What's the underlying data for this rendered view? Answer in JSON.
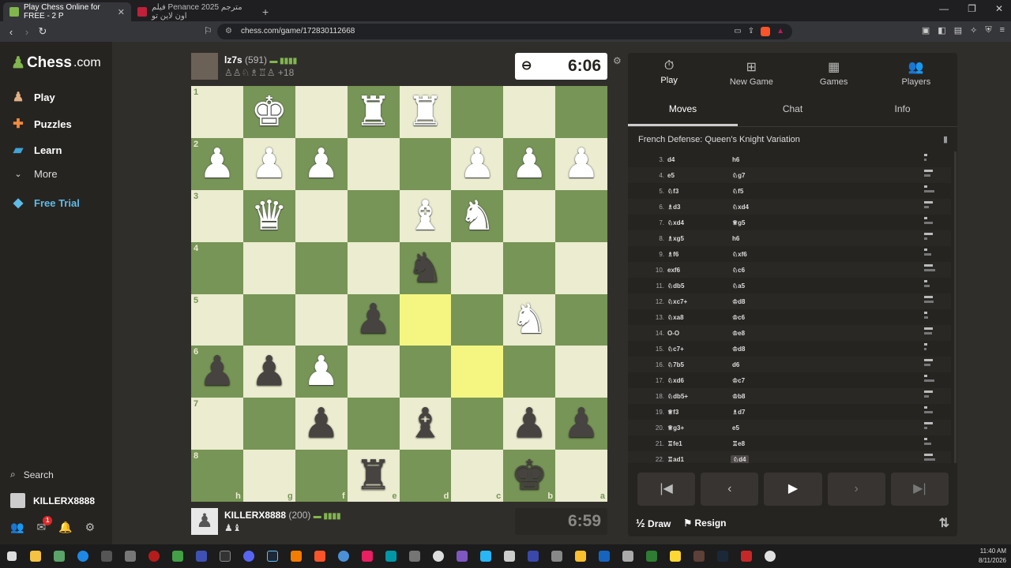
{
  "browser": {
    "tabs": [
      {
        "title": "Play Chess Online for FREE - 2 P",
        "active": true
      },
      {
        "title": "فیلم Penance 2025 مترجم اون لاین تو",
        "active": false
      }
    ],
    "url": "chess.com/game/172830112668"
  },
  "sidebar": {
    "logo_main": "Chess",
    "logo_suffix": ".com",
    "items": [
      {
        "label": "Play",
        "icon": "play-icon"
      },
      {
        "label": "Puzzles",
        "icon": "puzzle-icon"
      },
      {
        "label": "Learn",
        "icon": "learn-icon"
      },
      {
        "label": "More",
        "icon": "chevron-down-icon"
      },
      {
        "label": "Free Trial",
        "icon": "diamond-icon"
      }
    ],
    "search_label": "Search",
    "username": "KILLERX8888",
    "notifications": "1"
  },
  "top_player": {
    "name": "lz7s",
    "rating": "(591)",
    "captured": "♙♙♘♗♖♙ +18",
    "clock": "6:06"
  },
  "bottom_player": {
    "name": "KILLERX8888",
    "rating": "(200)",
    "captured": "♟♝",
    "clock": "6:59"
  },
  "board": {
    "orientation": "black",
    "ranks": [
      "1",
      "2",
      "3",
      "4",
      "5",
      "6",
      "7",
      "8"
    ],
    "files": [
      "h",
      "g",
      "f",
      "e",
      "d",
      "c",
      "b",
      "a"
    ],
    "rows": [
      [
        "",
        "wK",
        "",
        "wR",
        "wR",
        "",
        "",
        ""
      ],
      [
        "wP",
        "wP",
        "wP",
        "",
        "",
        "wP",
        "wP",
        "wP"
      ],
      [
        "",
        "wQ",
        "",
        "",
        "wB",
        "wN",
        "",
        ""
      ],
      [
        "",
        "",
        "",
        "",
        "bN",
        "",
        "",
        ""
      ],
      [
        "",
        "",
        "",
        "bP",
        "",
        "",
        "wN",
        ""
      ],
      [
        "bP",
        "bP",
        "wP",
        "",
        "",
        "",
        "",
        ""
      ],
      [
        "",
        "",
        "bP",
        "",
        "bB",
        "",
        "bP",
        "bP"
      ],
      [
        "",
        "",
        "",
        "bR",
        "",
        "",
        "bK",
        ""
      ]
    ],
    "highlights": [
      "4-4",
      "5-5"
    ]
  },
  "panel": {
    "tabs": [
      "Play",
      "New Game",
      "Games",
      "Players"
    ],
    "subtabs": [
      "Moves",
      "Chat",
      "Info"
    ],
    "opening": "French Defense: Queen's Knight Variation",
    "moves": [
      [
        "3.",
        "d4",
        "h6"
      ],
      [
        "4.",
        "e5",
        "♘g7"
      ],
      [
        "5.",
        "♘f3",
        "♘f5"
      ],
      [
        "6.",
        "♗d3",
        "♘xd4"
      ],
      [
        "7.",
        "♘xd4",
        "♕g5"
      ],
      [
        "8.",
        "♗xg5",
        "h6"
      ],
      [
        "9.",
        "♗f6",
        "♘xf6"
      ],
      [
        "10.",
        "exf6",
        "♘c6"
      ],
      [
        "11.",
        "♘db5",
        "♘a5"
      ],
      [
        "12.",
        "♘xc7+",
        "♔d8"
      ],
      [
        "13.",
        "♘xa8",
        "♔c6"
      ],
      [
        "14.",
        "O-O",
        "♔e8"
      ],
      [
        "15.",
        "♘c7+",
        "♔d8"
      ],
      [
        "16.",
        "♘7b5",
        "d6"
      ],
      [
        "17.",
        "♘xd6",
        "♔c7"
      ],
      [
        "18.",
        "♘db5+",
        "♔b8"
      ],
      [
        "19.",
        "♕f3",
        "♗d7"
      ],
      [
        "20.",
        "♕g3+",
        "e5"
      ],
      [
        "21.",
        "♖fe1",
        "♖e8"
      ],
      [
        "22.",
        "♖ad1",
        "♘d4"
      ]
    ],
    "draw_label": "Draw",
    "resign_label": "Resign"
  },
  "taskbar": {
    "time": "11:40 AM",
    "date": "8/11/2026"
  }
}
